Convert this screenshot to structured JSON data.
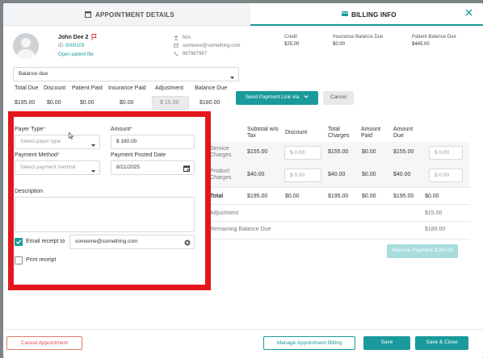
{
  "tabs": {
    "appointment_details": "APPOINTMENT DETAILS",
    "billing_info": "BILLING INFO"
  },
  "patient": {
    "name": "John Dee 2",
    "id_label": "ID:",
    "id_value": "0000103",
    "open_file": "Open patient file",
    "contact_name": "N/A",
    "email": "someone@something.com",
    "phone": "987987987"
  },
  "summary": {
    "credit_label": "Credit",
    "credit_value": "$25.00",
    "ins_label": "Insurance Balance Due",
    "ins_value": "$0.00",
    "pat_label": "Patient Balance Due",
    "pat_value": "$445.00"
  },
  "balance_select": "Balance due",
  "totals": {
    "headers": [
      "Total Due",
      "Discount",
      "Patient Paid",
      "Insurance Paid",
      "Adjustment",
      "Balance Due"
    ],
    "values": [
      "$195.00",
      "$0.00",
      "$0.00",
      "$0.00",
      "$ 15.00",
      "$180.00"
    ]
  },
  "buttons": {
    "send_link": "Send Payment Link via",
    "cancel": "Cancel",
    "receive": "Receive Payment $180.00",
    "cancel_appt": "Cancel Appointment",
    "manage": "Manage Appointment Billing",
    "save": "Save",
    "save_close": "Save & Close"
  },
  "form": {
    "payer_type_label": "Payer Type",
    "payer_type_placeholder": "Select payer type",
    "amount_label": "Amount",
    "amount_value": "$ 180.00",
    "payment_method_label": "Payment Method",
    "payment_method_placeholder": "Select payment method",
    "posted_date_label": "Payment Posted Date",
    "posted_date_value": "8/21/2025",
    "description_label": "Description",
    "email_receipt_label": "Email receipt to",
    "email_value": "someone@something.com",
    "print_receipt_label": "Print receipt"
  },
  "billing_table": {
    "headers": [
      "Subtotal w/o Tax",
      "Discount",
      "Total Charges",
      "Amount Paid",
      "Amount Due"
    ],
    "rows": [
      {
        "label": "Service Charges",
        "subtotal": "$155.00",
        "discount": "$ 0.00",
        "total": "$155.00",
        "paid": "$0.00",
        "due": "$155.00",
        "pay": "$ 0.00"
      },
      {
        "label": "Product Charges",
        "subtotal": "$40.00",
        "discount": "$ 0.00",
        "total": "$40.00",
        "paid": "$0.00",
        "due": "$40.00",
        "pay": "$ 0.00"
      }
    ],
    "total_row": {
      "label": "Total",
      "subtotal": "$195.00",
      "discount": "$0.00",
      "total": "$195.00",
      "paid": "$0.00",
      "due": "$195.00",
      "pay": "$0.00"
    },
    "adjustment_label": "Adjustment",
    "adjustment_value": "$15.00",
    "remaining_label": "Remaining Balance Due",
    "remaining_value": "$180.00"
  },
  "colors": {
    "accent": "#1a9a9c",
    "highlight": "#e3161e",
    "flag": "#e53935"
  }
}
